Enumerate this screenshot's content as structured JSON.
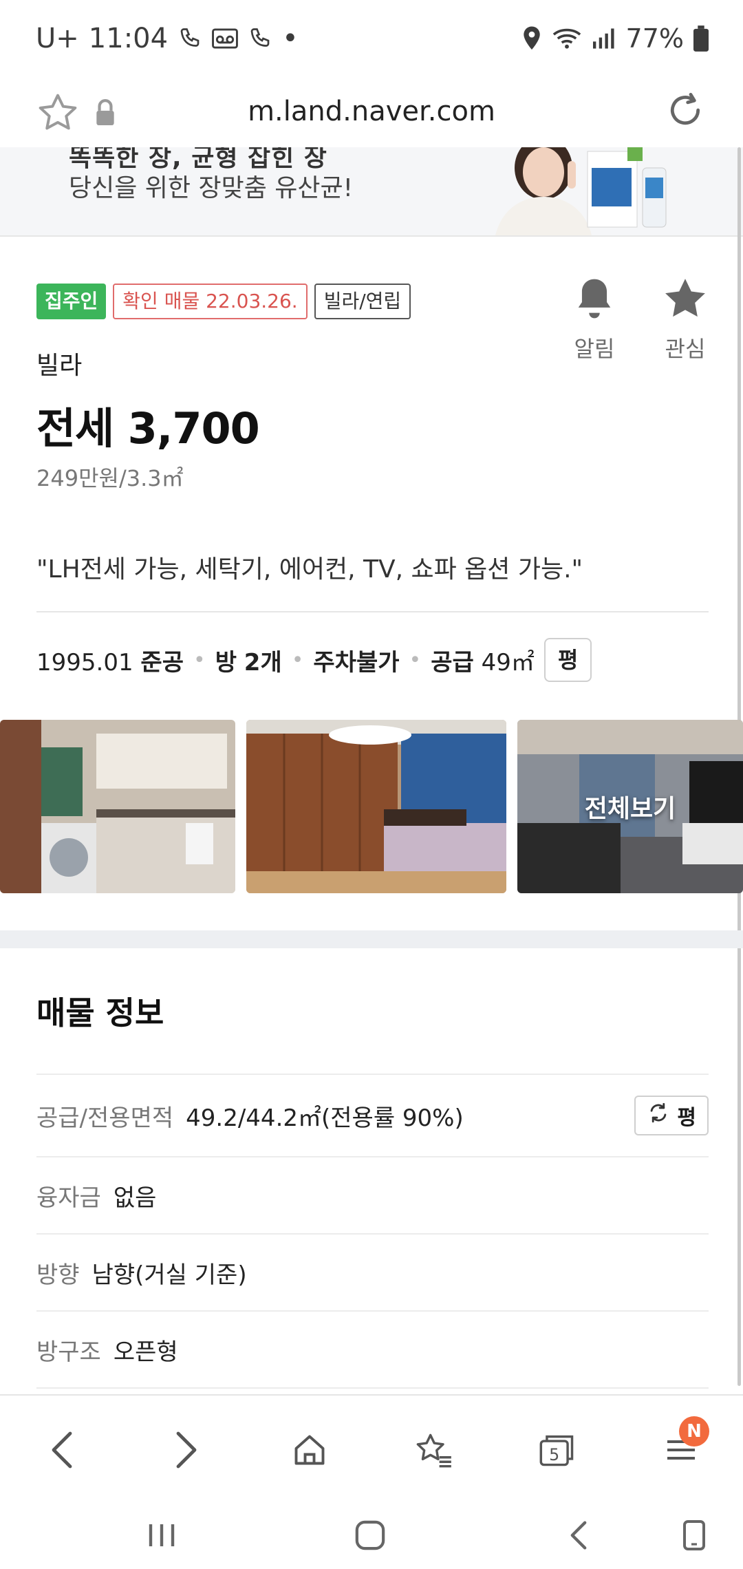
{
  "status_bar": {
    "carrier": "U+",
    "time": "11:04",
    "battery": "77%",
    "dot": "•"
  },
  "browser": {
    "url": "m.land.naver.com"
  },
  "ad": {
    "headline_partial": "똑똑한 장, 균형 잡힌 장",
    "text": "당신을 위한 장맞춤 유산균!"
  },
  "listing": {
    "badges": {
      "owner": "집주인",
      "verified": "확인 매물 22.03.26.",
      "type": "빌라/연립"
    },
    "actions": {
      "alarm": "알림",
      "favorite": "관심"
    },
    "property_type": "빌라",
    "price": "전세 3,700",
    "unit_price": "249만원/3.3㎡",
    "description": "\"LH전세 가능, 세탁기, 에어컨, TV, 쇼파 옵션 가능.\"",
    "facts": {
      "built_year": "1995.01",
      "built_label": "준공",
      "rooms_label": "방",
      "rooms_value": "2개",
      "parking": "주차불가",
      "supply_label": "공급",
      "supply_value": "49㎡",
      "unit_button": "평"
    },
    "photos": {
      "view_all": "전체보기"
    }
  },
  "info": {
    "title": "매물 정보",
    "rows": [
      {
        "key": "공급/전용면적",
        "value": "49.2/44.2㎡(전용률 90%)"
      },
      {
        "key": "융자금",
        "value": "없음"
      },
      {
        "key": "방향",
        "value": "남향(거실 기준)"
      },
      {
        "key": "방구조",
        "value": "오픈형"
      }
    ],
    "unit_toggle": "평"
  },
  "toolbar": {
    "tab_count": "5",
    "menu_badge": "N"
  }
}
